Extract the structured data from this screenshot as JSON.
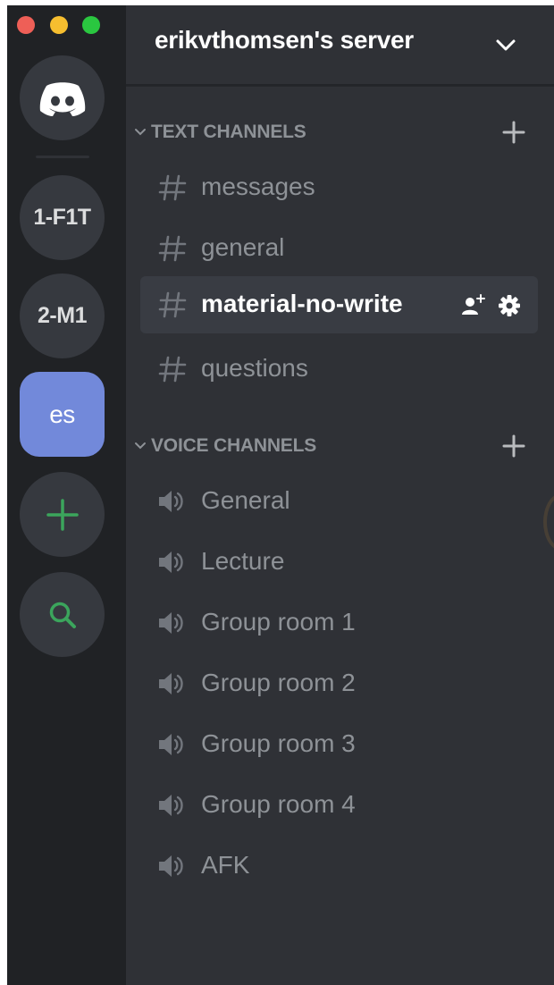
{
  "server": {
    "name": "erikvthomsen's server"
  },
  "rail": {
    "servers": [
      {
        "label": "1-F1T"
      },
      {
        "label": "2-M1"
      },
      {
        "label": "es"
      }
    ]
  },
  "text_category": {
    "label": "TEXT CHANNELS"
  },
  "voice_category": {
    "label": "VOICE CHANNELS"
  },
  "text_channels": [
    {
      "label": "messages"
    },
    {
      "label": "general"
    },
    {
      "label": "material-no-write"
    },
    {
      "label": "questions"
    }
  ],
  "voice_channels": [
    {
      "label": "General"
    },
    {
      "label": "Lecture"
    },
    {
      "label": "Group room 1"
    },
    {
      "label": "Group room 2"
    },
    {
      "label": "Group room 3"
    },
    {
      "label": "Group room 4"
    },
    {
      "label": "AFK"
    }
  ],
  "colors": {
    "accent": "#7289da",
    "green": "#3ba55c",
    "rail_bg": "#202225",
    "channels_bg": "#2f3136",
    "muted_text": "#8e9297"
  },
  "icons": {
    "home": "discord-logo-icon",
    "add_server": "plus-icon",
    "discover": "search-icon",
    "text_channel": "hash-icon",
    "voice_channel": "speaker-icon",
    "invite": "add-user-icon",
    "settings": "gear-icon"
  }
}
